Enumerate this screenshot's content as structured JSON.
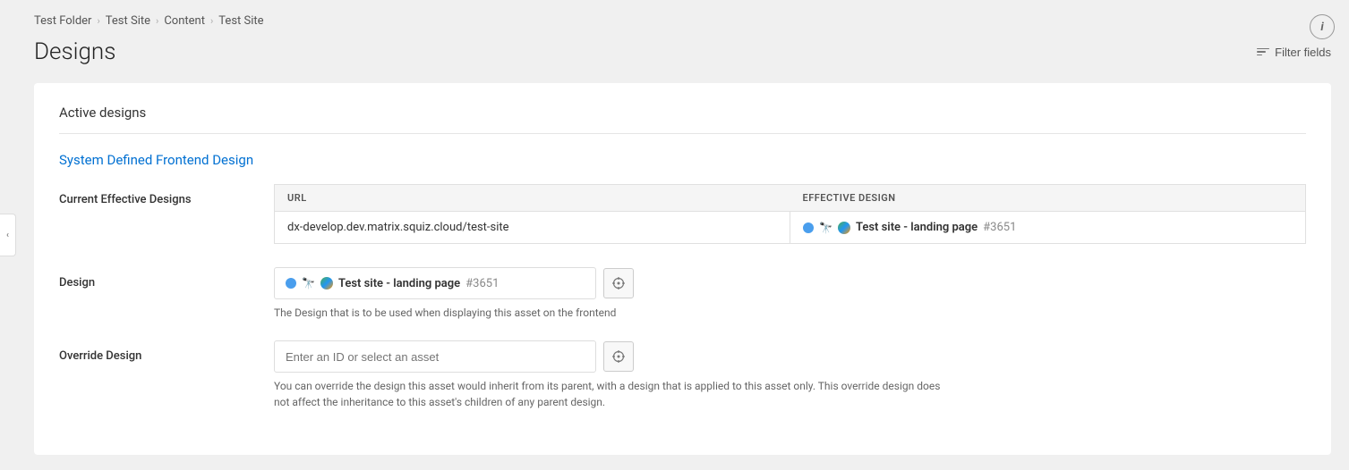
{
  "breadcrumb": {
    "items": [
      "Test Folder",
      "Test Site",
      "Content",
      "Test Site"
    ],
    "separators": [
      ">",
      ">",
      ">"
    ]
  },
  "page": {
    "title": "Designs",
    "filter_label": "Filter fields"
  },
  "card": {
    "section_title": "Active designs",
    "subsection_title": "System Defined Frontend Design",
    "fields": [
      {
        "id": "current-effective-designs",
        "label": "Current Effective Designs",
        "table": {
          "columns": [
            "URL",
            "EFFECTIVE DESIGN"
          ],
          "rows": [
            {
              "url": "dx-develop.dev.matrix.squiz.cloud/test-site",
              "design_name": "Test site - landing page",
              "design_id": "#3651"
            }
          ]
        }
      },
      {
        "id": "design",
        "label": "Design",
        "value": "Test site - landing page",
        "asset_id": "#3651",
        "hint": "The Design that is to be used when displaying this asset on the frontend"
      },
      {
        "id": "override-design",
        "label": "Override Design",
        "placeholder": "Enter an ID or select an asset",
        "hint": "You can override the design this asset would inherit from its parent, with a design that is applied to this asset only. This override design does\nnot affect the inheritance to this asset's children of any parent design."
      }
    ]
  },
  "icons": {
    "info": "i",
    "chevron_left": "‹",
    "crosshair": "⊕"
  }
}
